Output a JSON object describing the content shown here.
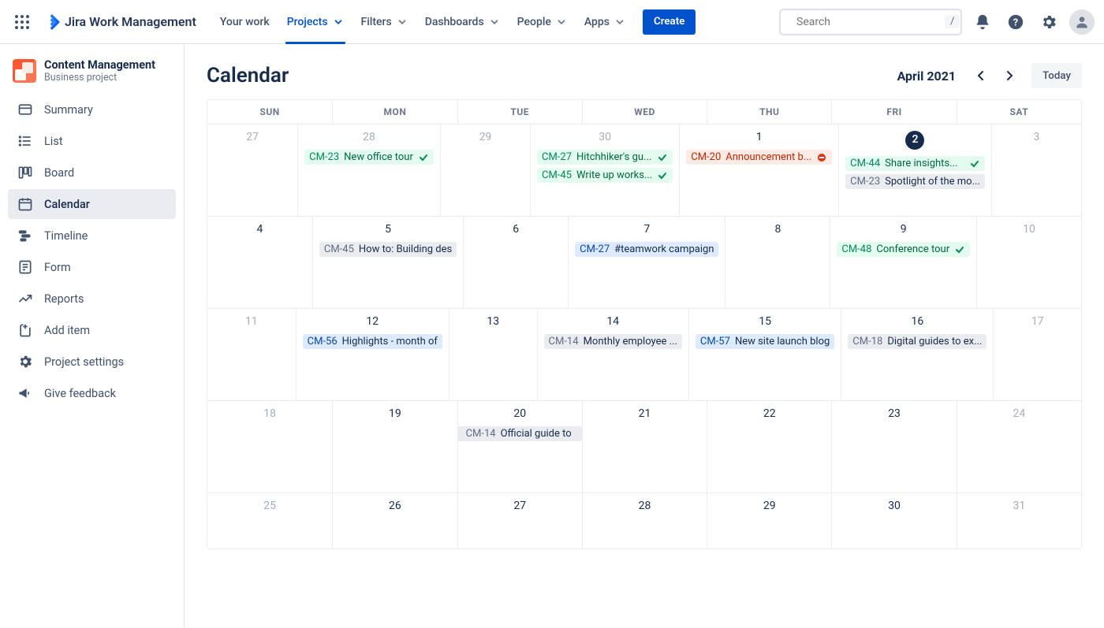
{
  "product_name": "Jira Work Management",
  "top_nav": {
    "your_work": "Your work",
    "projects": "Projects",
    "filters": "Filters",
    "dashboards": "Dashboards",
    "people": "People",
    "apps": "Apps",
    "create": "Create"
  },
  "search": {
    "placeholder": "Search",
    "shortcut": "/"
  },
  "project": {
    "name": "Content Management",
    "type": "Business project"
  },
  "sidebar": {
    "summary": "Summary",
    "list": "List",
    "board": "Board",
    "calendar": "Calendar",
    "timeline": "Timeline",
    "form": "Form",
    "reports": "Reports",
    "add_item": "Add item",
    "settings": "Project settings",
    "feedback": "Give feedback"
  },
  "page": {
    "title": "Calendar",
    "month": "April 2021",
    "today": "Today"
  },
  "dow": {
    "sun": "SUN",
    "mon": "MON",
    "tue": "TUE",
    "wed": "WED",
    "thu": "THU",
    "fri": "FRI",
    "sat": "SAT"
  },
  "days": {
    "w1": [
      "27",
      "28",
      "29",
      "30",
      "1",
      "2",
      "3"
    ],
    "w2": [
      "4",
      "5",
      "6",
      "7",
      "8",
      "9",
      "10"
    ],
    "w3": [
      "11",
      "12",
      "13",
      "14",
      "15",
      "16",
      "17"
    ],
    "w4": [
      "18",
      "19",
      "20",
      "21",
      "22",
      "23",
      "24"
    ],
    "w5": [
      "25",
      "26",
      "27",
      "28",
      "29",
      "30",
      "31"
    ]
  },
  "events": {
    "e1": {
      "key": "CM-23",
      "title": "New office tour"
    },
    "e2": {
      "key": "CM-27",
      "title": "Hitchhiker's gu..."
    },
    "e3": {
      "key": "CM-45",
      "title": "Write up works..."
    },
    "e4": {
      "key": "CM-20",
      "title": "Announcement b..."
    },
    "e5": {
      "key": "CM-44",
      "title": "Share insights..."
    },
    "e6": {
      "key": "CM-23",
      "title": "Spotlight of the mo..."
    },
    "e7": {
      "key": "CM-45",
      "title": "How to: Building des"
    },
    "e8": {
      "key": "CM-27",
      "title": "#teamwork campaign"
    },
    "e9": {
      "key": "CM-48",
      "title": "Conference tour"
    },
    "e10": {
      "key": "CM-56",
      "title": "Highlights - month of"
    },
    "e11": {
      "key": "CM-14",
      "title": "Monthly employee ..."
    },
    "e12": {
      "key": "CM-57",
      "title": "New site launch blog"
    },
    "e13": {
      "key": "CM-18",
      "title": "Digital guides to ex..."
    },
    "e14": {
      "key": "CM-14",
      "title": "Official guide to"
    }
  }
}
